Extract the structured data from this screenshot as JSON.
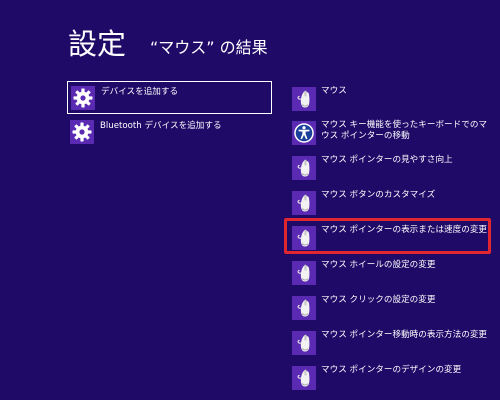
{
  "header": {
    "title": "設定",
    "subtitle": "“マウス” の結果"
  },
  "left_results": [
    {
      "label": "デバイスを追加する",
      "icon": "gear-icon"
    },
    {
      "label": "Bluetooth デバイスを追加する",
      "icon": "gear-icon"
    }
  ],
  "right_results": [
    {
      "label": "マウス",
      "icon": "mouse-icon"
    },
    {
      "label": "マウス キー機能を使ったキーボードでのマウス ポインターの移動",
      "icon": "ease-of-access-icon"
    },
    {
      "label": "マウス ポインターの見やすさ向上",
      "icon": "mouse-icon"
    },
    {
      "label": "マウス ボタンのカスタマイズ",
      "icon": "mouse-icon"
    },
    {
      "label": "マウス ポインターの表示または速度の変更",
      "icon": "mouse-icon"
    },
    {
      "label": "マウス ホイールの設定の変更",
      "icon": "mouse-icon"
    },
    {
      "label": "マウス クリックの設定の変更",
      "icon": "mouse-icon"
    },
    {
      "label": "マウス ポインター移動時の表示方法の変更",
      "icon": "mouse-icon"
    },
    {
      "label": "マウス ポインターのデザインの変更",
      "icon": "mouse-icon"
    }
  ],
  "colors": {
    "background": "#1f0a68",
    "tile": "#5b2ab3",
    "highlight": "#e2262f",
    "text": "#ffffff"
  }
}
